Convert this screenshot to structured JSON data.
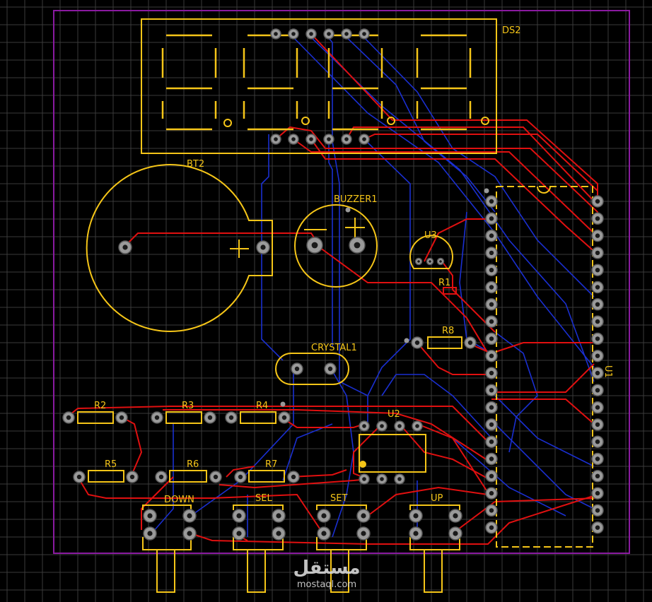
{
  "labels": {
    "ds2": "DS2",
    "bt2": "BT2",
    "buzzer": "BUZZER1",
    "u3": "U3",
    "r1": "R1",
    "r8": "R8",
    "crystal": "CRYSTAL1",
    "u1": "U1",
    "u2": "U2",
    "r2": "R2",
    "r3": "R3",
    "r4": "R4",
    "r5": "R5",
    "r6": "R6",
    "r7": "R7",
    "down": "DOWN",
    "sel": "SEL",
    "set": "SET",
    "up": "UP"
  },
  "watermark": {
    "arabic": "مستقل",
    "latin": "mostaql.com"
  },
  "colors": {
    "background": "#000000",
    "grid": "#3a3a3a",
    "board_outline": "#8a1aa0",
    "silkscreen": "#f5c518",
    "top_copper": "#e01010",
    "bottom_copper": "#1a2fd0",
    "pad": "#9a9a9a"
  }
}
